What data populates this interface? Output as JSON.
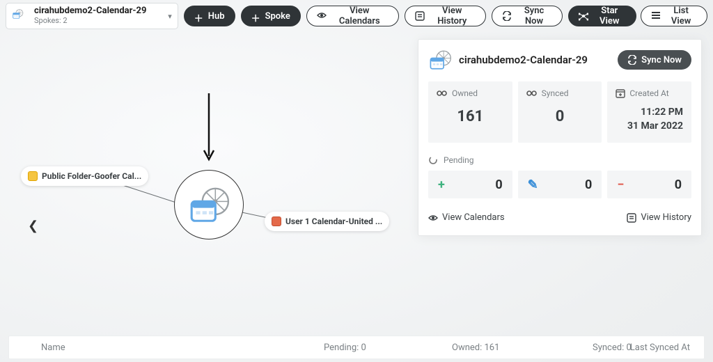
{
  "hubSelector": {
    "title": "cirahubdemo2-Calendar-29",
    "subtitle": "Spokes: 2"
  },
  "toolbar": {
    "hub_label": "Hub",
    "spoke_label": "Spoke",
    "view_calendars_label": "View Calendars",
    "view_history_label": "View History",
    "sync_now_label": "Sync Now",
    "star_view_label": "Star View",
    "list_view_label": "List View"
  },
  "spokes": {
    "left": "Public Folder-Goofer Cal...",
    "right": "User 1 Calendar-United ..."
  },
  "panel": {
    "title": "cirahubdemo2-Calendar-29",
    "sync_now_label": "Sync Now",
    "owned_label": "Owned",
    "owned_value": "161",
    "synced_label": "Synced",
    "synced_value": "0",
    "created_label": "Created At",
    "created_time": "11:22 PM",
    "created_date": "31 Mar 2022",
    "pending_label": "Pending",
    "pending_add": "0",
    "pending_edit": "0",
    "pending_remove": "0",
    "view_calendars": "View Calendars",
    "view_history": "View History"
  },
  "bottomBar": {
    "name": "Name",
    "pending": "Pending: 0",
    "owned": "Owned: 161",
    "synced": "Synced: 0",
    "last": "Last Synced At"
  }
}
